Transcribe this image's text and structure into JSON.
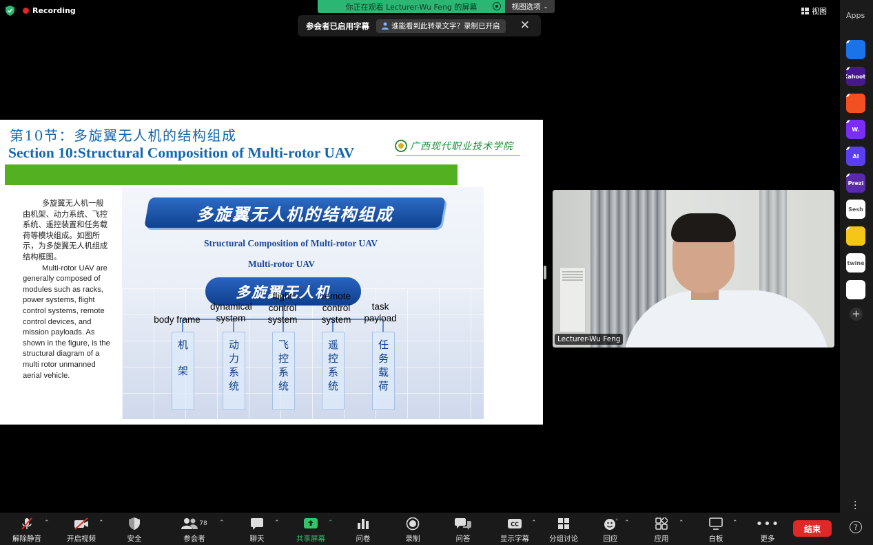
{
  "top": {
    "recording_label": "Recording",
    "share_banner": "你正在观看 Lecturer-Wu Feng 的屏幕",
    "view_options": "视图选项",
    "caption_notice": "参会者已启用字幕",
    "caption_who": "谁能看到此转录文字？录制已开启",
    "view_label": "视图"
  },
  "apps": {
    "title": "Apps",
    "items": [
      {
        "name": "app-1",
        "label": "",
        "color": "#1a73e8"
      },
      {
        "name": "kahoot",
        "label": "Kahoot!",
        "color": "#46178f"
      },
      {
        "name": "app-3",
        "label": "",
        "color": "#f25022"
      },
      {
        "name": "app-w",
        "label": "W.",
        "color": "#7b2cf5"
      },
      {
        "name": "app-ai",
        "label": "AI",
        "color": "#5b3df5"
      },
      {
        "name": "prezi",
        "label": "Prezi",
        "color": "#5a2aa8"
      },
      {
        "name": "sesh",
        "label": "Sesh",
        "color": "#ffffff"
      },
      {
        "name": "app-face",
        "label": "",
        "color": "#f5c518"
      },
      {
        "name": "twine",
        "label": "twine",
        "color": "#ffffff"
      },
      {
        "name": "app-blocks",
        "label": "",
        "color": "#ffffff"
      }
    ]
  },
  "slide": {
    "title_cn": "第10节：多旋翼无人机的结构组成",
    "title_en": "Section 10:Structural Composition of Multi-rotor UAV",
    "school": "广西现代职业技术学院",
    "paragraph_cn": "多旋翼无人机一般由机架、动力系统、飞控系统、遥控装置和任务载荷等模块组成。如图所示，为多旋翼无人机组成结构框图。",
    "paragraph_en": "Multi-rotor UAV are generally composed of modules such as racks, power systems, flight control systems, remote control devices, and mission payloads. As shown in the figure, is the structural diagram of a multi rotor unmanned aerial vehicle.",
    "diagram": {
      "banner": "多旋翼无人机的结构组成",
      "sub_en_1": "Structural Composition of Multi-rotor UAV",
      "sub_en_2": "Multi-rotor UAV",
      "center": "多旋翼无人机",
      "modules": [
        {
          "en": "body frame",
          "cn": [
            "机",
            "架"
          ]
        },
        {
          "en": "dynamical system",
          "cn": [
            "动",
            "力",
            "系",
            "统"
          ]
        },
        {
          "en": "flight control system",
          "cn": [
            "飞",
            "控",
            "系",
            "统"
          ]
        },
        {
          "en": "remote control system",
          "cn": [
            "遥",
            "控",
            "系",
            "统"
          ]
        },
        {
          "en": "task payload",
          "cn": [
            "任",
            "务",
            "载",
            "荷"
          ]
        }
      ]
    }
  },
  "video": {
    "name": "Lecturer-Wu Feng"
  },
  "toolbar": {
    "unmute": "解除静音",
    "start_video": "开启视频",
    "security": "安全",
    "participants": "参会者",
    "participants_count": "78",
    "chat": "聊天",
    "share": "共享屏幕",
    "polls": "问卷",
    "record": "录制",
    "qa": "问答",
    "captions": "显示字幕",
    "breakout": "分组讨论",
    "reactions": "回应",
    "apps": "应用",
    "whiteboard": "白板",
    "more": "更多",
    "end": "结束"
  }
}
